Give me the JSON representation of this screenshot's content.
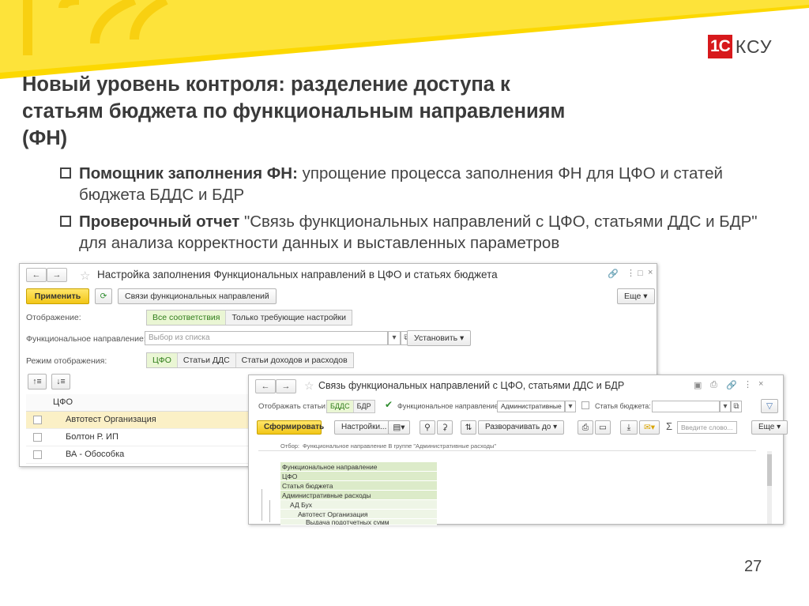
{
  "brand": {
    "mark": "1С",
    "name": "КСУ",
    "accent": "#d7191c",
    "banner_color": "#fbd700"
  },
  "slide": {
    "title_lines": [
      "Новый уровень контроля: разделение доступа к",
      "статьям бюджета по функциональным направлениям",
      "(ФН)"
    ],
    "bullets": [
      {
        "bold": "Помощник заполнения ФН:",
        "text": " упрощение процесса заполнения ФН для ЦФО и статей бюджета БДДС и БДР"
      },
      {
        "bold": "Проверочный отчет",
        "text": " \"Связь функциональных направлений с ЦФО, статьями ДДС и БДР\" для анализа корректности данных и выставленных параметров"
      }
    ],
    "page_number": "27"
  },
  "window1": {
    "title": "Настройка заполнения Функциональных направлений в ЦФО и статьях бюджета",
    "apply_label": "Применить",
    "links_button": "Связи функциональных направлений",
    "more_label": "Еще",
    "display_label": "Отображение:",
    "display_options": [
      "Все соответствия",
      "Только требующие настройки"
    ],
    "direction_label": "Функциональное направление:",
    "direction_placeholder": "Выбор из списка",
    "set_button": "Установить",
    "mode_label": "Режим отображения:",
    "mode_options": [
      "ЦФО",
      "Статьи ДДС",
      "Статьи доходов и расходов"
    ],
    "table_header": "ЦФО",
    "rows": [
      "Автотест Организация",
      "Болтон Р. ИП",
      "ВА - Обособка"
    ]
  },
  "window2": {
    "title": "Связь функциональных направлений с ЦФО, статьями ДДС и БДР",
    "show_label": "Отображать статьи:",
    "show_options": [
      "БДДС",
      "БДР"
    ],
    "direction_label": "Функциональное направление:",
    "direction_value": "Административные",
    "budget_label": "Статья бюджета:",
    "generate_label": "Сформировать",
    "settings_label": "Настройки...",
    "expand_label": "Разворачивать до",
    "search_placeholder": "Введите слово...",
    "more_label": "Еще",
    "filter_prefix": "Отбор:",
    "filter_text": "Функциональное направление В группе \"Административные расходы\"",
    "report_rows": [
      "Функциональное направление",
      "ЦФО",
      "Статья бюджета",
      "Административные расходы",
      "АД Бух",
      "Автотест Организация",
      "Выдача подотчетных сумм"
    ]
  }
}
